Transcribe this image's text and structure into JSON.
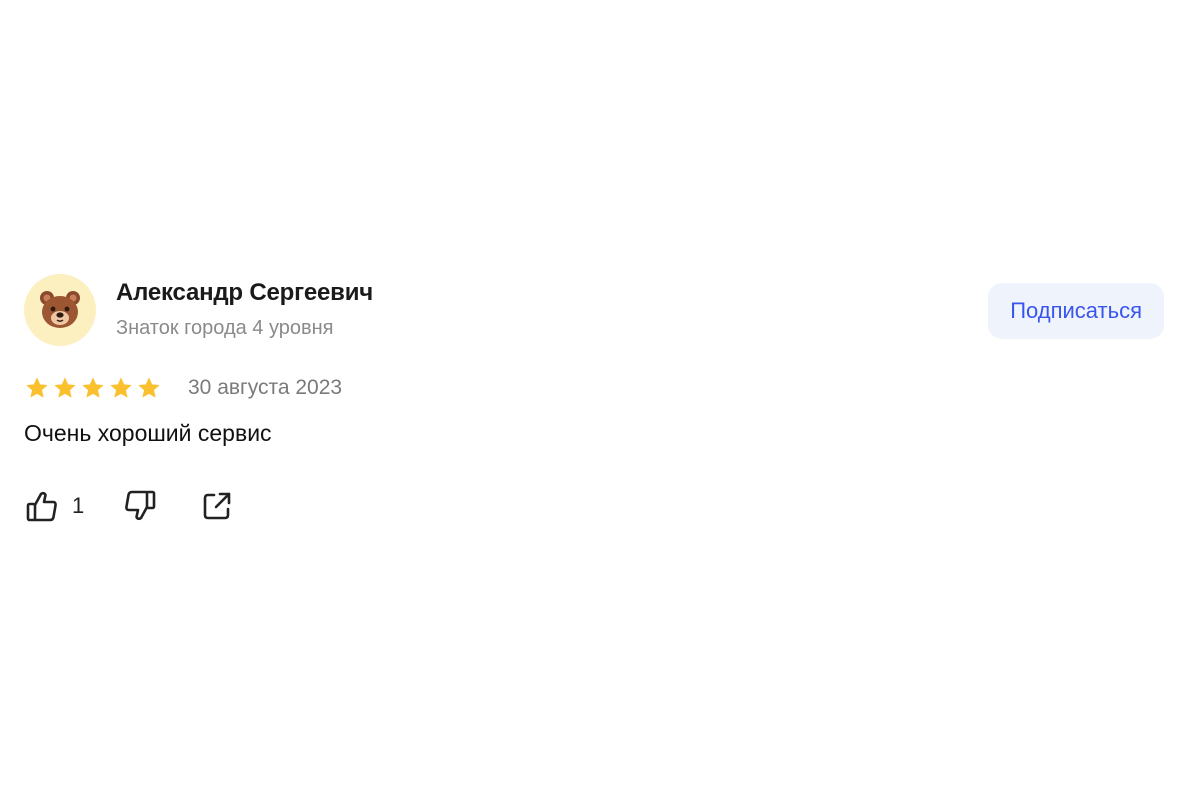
{
  "review": {
    "author": {
      "name": "Александр Сергеевич",
      "level": "Знаток города 4 уровня",
      "avatar_icon": "bear-face-icon",
      "avatar_bg": "#fcefc0"
    },
    "subscribe_label": "Подписаться",
    "rating": {
      "value": 5,
      "max": 5,
      "color": "#fbc02d"
    },
    "date": "30 августа 2023",
    "text": "Очень хороший сервис",
    "actions": {
      "like_icon": "thumbs-up-icon",
      "like_count": "1",
      "dislike_icon": "thumbs-down-icon",
      "share_icon": "share-icon"
    }
  }
}
